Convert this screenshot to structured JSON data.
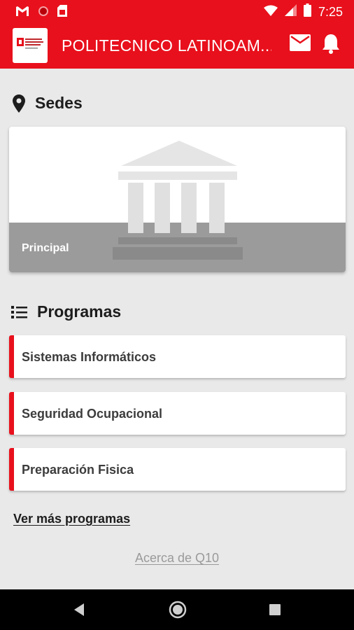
{
  "status_bar": {
    "time": "7:25",
    "left_icons": [
      "gmail-icon",
      "record-icon",
      "sim-card-icon"
    ],
    "right_icons": [
      "wifi-icon",
      "signal-icon",
      "battery-icon"
    ]
  },
  "app_bar": {
    "title": "POLITECNICO LATINOAM...",
    "icons": [
      "mail-icon",
      "bell-icon"
    ]
  },
  "sedes": {
    "title": "Sedes",
    "cards": [
      {
        "label": "Principal"
      }
    ]
  },
  "programas": {
    "title": "Programas",
    "items": [
      {
        "name": "Sistemas Informáticos"
      },
      {
        "name": "Seguridad Ocupacional"
      },
      {
        "name": "Preparación Fisica"
      }
    ],
    "more_label": "Ver más programas"
  },
  "footer": {
    "about_label": "Acerca de Q10"
  },
  "colors": {
    "accent": "#e8101c",
    "background": "#e9e9e9",
    "card_band": "#9b9b9b"
  }
}
